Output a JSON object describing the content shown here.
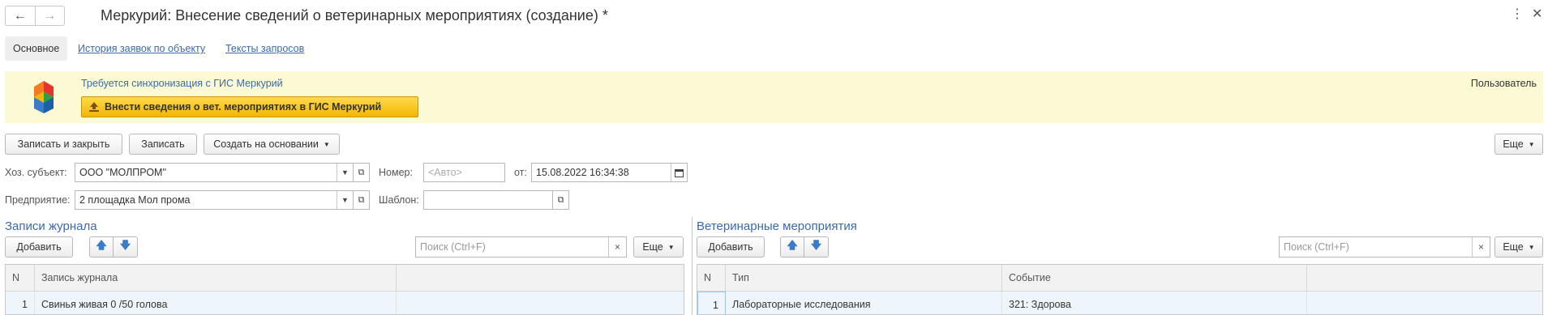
{
  "window": {
    "title": "Меркурий: Внесение сведений о ветеринарных мероприятиях (создание) *",
    "back_icon": "←",
    "forward_icon": "→",
    "more_icon": "⋮",
    "close_icon": "✕"
  },
  "tabs": [
    {
      "label": "Основное",
      "active": true
    },
    {
      "label": "История заявок по объекту",
      "active": false
    },
    {
      "label": "Тексты запросов",
      "active": false
    }
  ],
  "banner": {
    "message": "Требуется синхронизация с ГИС Меркурий",
    "sync_button": "Внести сведения о вет. мероприятиях в ГИС Меркурий",
    "user_label": "Пользователь",
    "background": "#fbfad5",
    "button_color": "#f2b705"
  },
  "toolbar": {
    "save_close": "Записать и закрыть",
    "save": "Записать",
    "create_based": "Создать на основании",
    "more": "Еще"
  },
  "form": {
    "entity_label": "Хоз. субъект:",
    "entity_value": "ООО \"МОЛПРОМ\"",
    "number_label": "Номер:",
    "number_placeholder": "<Авто>",
    "from_label": "от:",
    "date_value": "15.08.2022 16:34:38",
    "enterprise_label": "Предприятие:",
    "enterprise_value": "2 площадка Мол прома",
    "template_label": "Шаблон:",
    "template_value": ""
  },
  "journal": {
    "title": "Записи журнала",
    "add": "Добавить",
    "search_placeholder": "Поиск (Ctrl+F)",
    "more": "Еще",
    "columns": [
      "N",
      "Запись журнала",
      ""
    ],
    "rows": [
      {
        "n": "1",
        "record": "Свинья живая 0 /50 голова",
        "extra": ""
      }
    ]
  },
  "vet": {
    "title": "Ветеринарные мероприятия",
    "add": "Добавить",
    "search_placeholder": "Поиск (Ctrl+F)",
    "more": "Еще",
    "columns": [
      "N",
      "Тип",
      "Событие",
      ""
    ],
    "rows": [
      {
        "n": "1",
        "type": "Лабораторные исследования",
        "event": "321: Здорова",
        "extra": ""
      }
    ]
  },
  "colors": {
    "link": "#3b6aa8",
    "accent_arrow": "#3a7cc9",
    "selected_row": "#eef6fc"
  }
}
